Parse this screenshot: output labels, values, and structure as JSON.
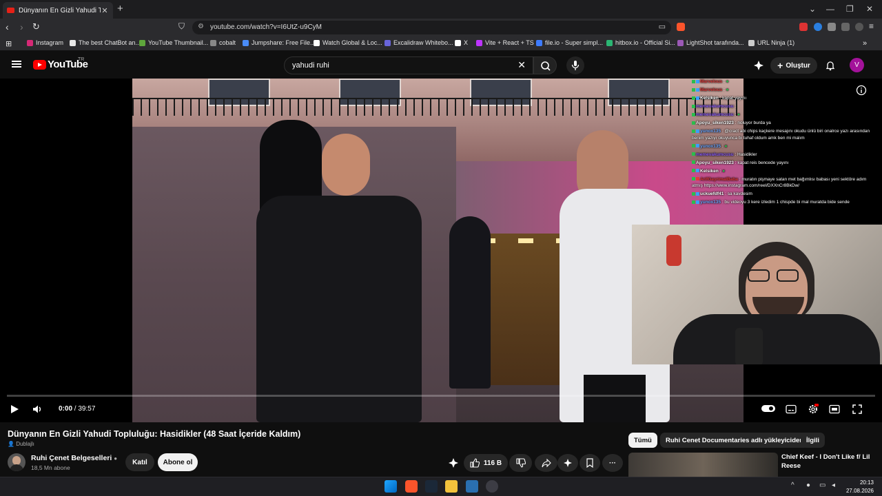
{
  "browser": {
    "tab_title": "Dünyanın En Gizli Yahudi Toplu",
    "url": "youtube.com/watch?v=I6UtZ-u9CyM",
    "bookmarks": [
      "Instagram",
      "The best ChatBot an...",
      "YouTube Thumbnail...",
      "cobalt",
      "Jumpshare: Free File...",
      "Watch Global & Loc...",
      "Excalidraw Whitebo...",
      "X",
      "Vite + React + TS",
      "file.io - Super simpl...",
      "hitbox.io - Official Si...",
      "LightShot tarafında...",
      "URL Ninja (1)"
    ],
    "bookmark_colors": [
      "#d62976",
      "#e8e8e8",
      "#5fa73c",
      "#888888",
      "#4a8cf7",
      "#ffffff",
      "#6965db",
      "#ffffff",
      "#bd34fe",
      "#3d7bff",
      "#2bb673",
      "#9b59b6",
      "#cccccc"
    ]
  },
  "youtube": {
    "logo_text": "YouTube",
    "region": "TR",
    "search_query": "yahudi ruhi",
    "create_label": "Oluştur",
    "avatar_letter": "V"
  },
  "player": {
    "time_current": "0:00",
    "time_total": "39:57",
    "progress": 0.0
  },
  "chat": [
    {
      "user": "Marvelous",
      "text": ":",
      "color": "#d93a3a"
    },
    {
      "user": "Marvelous",
      "text": ":",
      "color": "#d93a3a"
    },
    {
      "user": "Kelsiken",
      "text": ": kapat yayını",
      "color": "#ffffff"
    },
    {
      "user": "memevakumcusu",
      "text": ":",
      "color": "#8b5cf6"
    },
    {
      "user": "memevakumcusu",
      "text": ":",
      "color": "#8b5cf6"
    },
    {
      "user": "Apoyu_siken1923",
      "text": ": noluyor burda ya",
      "color": "#ffffff"
    },
    {
      "user": "yunox135",
      "text": ": @cract abi chips kaçkere mesajını okudu ünlü biri onalrce yazı arasından benim yazıyı okuyunca bi tuhaf oldum amk ben mi malım",
      "color": "#6fa8ff"
    },
    {
      "user": "yunox135",
      "text": ":",
      "color": "#6fa8ff"
    },
    {
      "user": "memevakumcusu",
      "text": ": Hasidikler",
      "color": "#8b5cf6"
    },
    {
      "user": "Apoyu_siken1923",
      "text": ": kapat reis bencede yayını",
      "color": "#ffffff"
    },
    {
      "user": "Kelsiken",
      "text": ":",
      "color": "#ffffff"
    },
    {
      "user": "ArifGayrimalBaba",
      "text": ": muratın pişmaye satan met bağımlısı babası yeni sektöre adım atmış https://www.instagram.com/reel/DXXnCr8BkDw/",
      "color": "#e23b3b"
    },
    {
      "user": "uckuefdf41",
      "text": ": sa kavdesim",
      "color": "#ffffff"
    },
    {
      "user": "yunox135",
      "text": ": bu videoyu 3 kere izledim 1 chispde bi mal muratda bide sende",
      "color": "#6fa8ff"
    }
  ],
  "video": {
    "title": "Dünyanın En Gizli Yahudi Topluluğu: Hasidikler (48 Saat İçeride Kaldım)",
    "dub_label": "Dublajlı",
    "channel": "Ruhi Çenet Belgeselleri",
    "subscribers": "18,5 Mn abone",
    "join_label": "Katıl",
    "subscribe_label": "Abone ol",
    "likes": "116 B"
  },
  "filters": [
    "Tümü",
    "Ruhi Cenet Documentaries adlı yükleyiciden",
    "İlgili"
  ],
  "recommended": {
    "title": "Chief Keef - I Don't Like f/ Lil Reese"
  },
  "taskbar": {
    "time": "20:13",
    "date": "27.08.2026"
  }
}
